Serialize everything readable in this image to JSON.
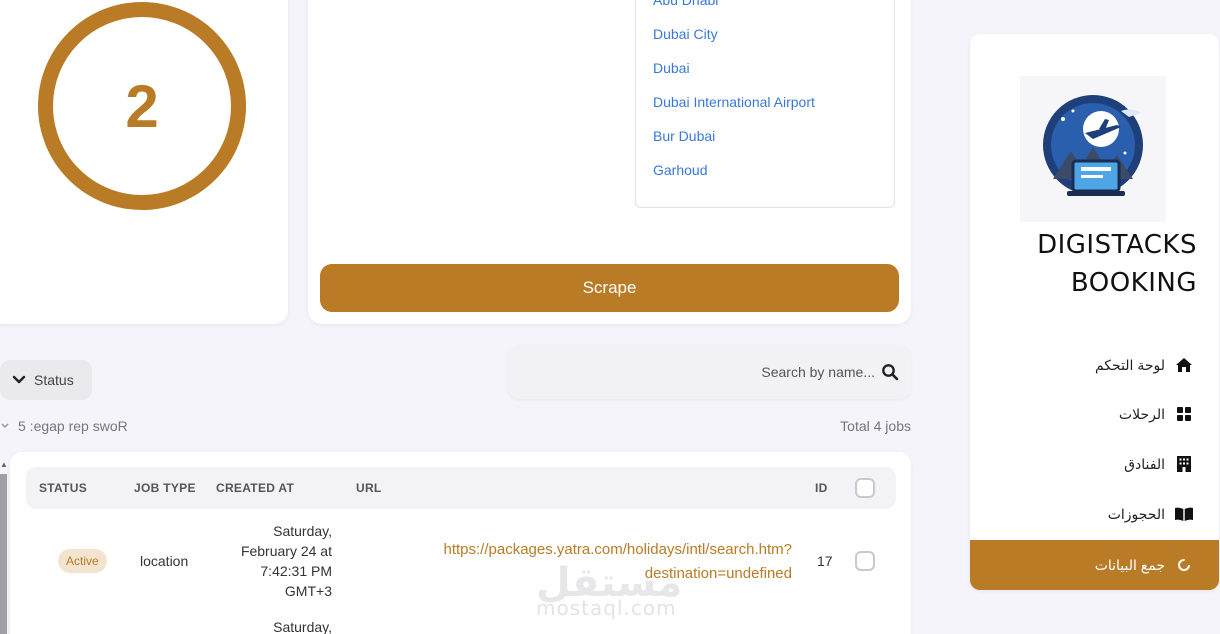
{
  "stats": {
    "count": "2"
  },
  "locations": [
    "Abu Dhabi",
    "Dubai City",
    "Dubai",
    "Dubai International Airport",
    "Bur Dubai",
    "Garhoud"
  ],
  "scrape": {
    "button_label": "Scrape"
  },
  "search": {
    "placeholder": "Search by name..."
  },
  "filters": {
    "status_label": "Status"
  },
  "pagination": {
    "rows_per_page": "Rows per page: 5",
    "total": "Total 4 jobs"
  },
  "table": {
    "headers": {
      "status": "STATUS",
      "job_type": "JOB TYPE",
      "created_at": "CREATED AT",
      "url": "URL",
      "id": "ID"
    },
    "rows": [
      {
        "status": "Active",
        "job_type": "location",
        "created_at": "Saturday, February 24 at 7:42:31 PM GMT+3",
        "url": "https://packages.yatra.com/holidays/intl/search.htm?destination=undefined",
        "id": "17"
      },
      {
        "created_at": "Saturday,"
      }
    ]
  },
  "sidebar": {
    "brand_line1": "DIGISTACKS",
    "brand_line2": "BOOKING",
    "items": [
      {
        "label": "لوحة التحكم",
        "icon": "home-icon"
      },
      {
        "label": "الرحلات",
        "icon": "grid-icon"
      },
      {
        "label": "الفنادق",
        "icon": "building-icon"
      },
      {
        "label": "الحجوزات",
        "icon": "book-icon"
      },
      {
        "label": "جمع البيانات",
        "icon": "spinner-icon"
      }
    ]
  },
  "watermark": {
    "arabic": "مستقل",
    "latin": "mostaql.com"
  },
  "colors": {
    "accent": "#b97b25",
    "link": "#3a78d6",
    "background": "#f4f4fa"
  }
}
